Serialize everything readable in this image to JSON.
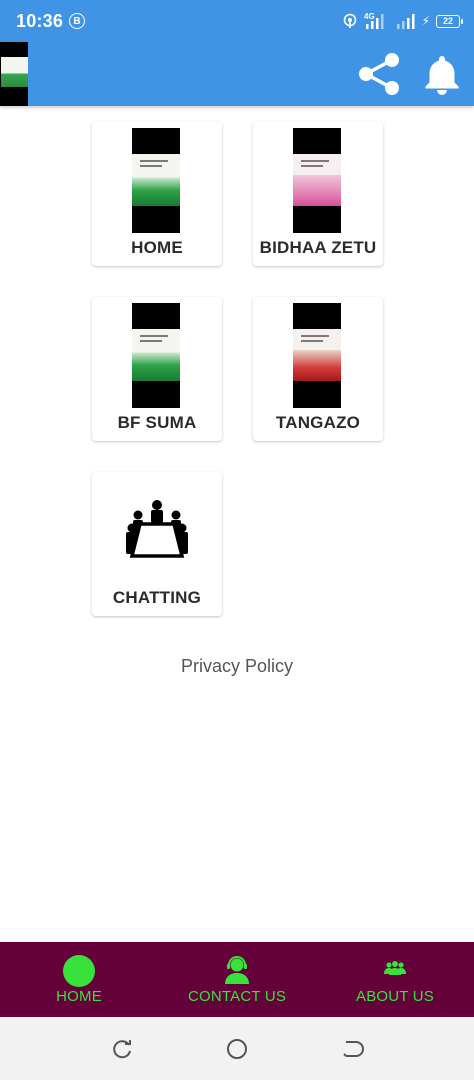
{
  "status_bar": {
    "time": "10:36",
    "b_badge": "B",
    "network": "4G",
    "battery": "22"
  },
  "app_bar": {
    "logo_icon": "app-logo",
    "share_icon": "share-icon",
    "bell_icon": "bell-icon"
  },
  "menu": {
    "items": [
      {
        "label": "HOME",
        "thumb": "green"
      },
      {
        "label": "BIDHAA ZETU",
        "thumb": "pink"
      },
      {
        "label": "BF SUMA",
        "thumb": "green"
      },
      {
        "label": "TANGAZO",
        "thumb": "red"
      },
      {
        "label": "CHATTING",
        "icon": "meeting-table-icon"
      }
    ]
  },
  "privacy_link": "Privacy Policy",
  "bottom_nav": {
    "items": [
      {
        "label": "HOME",
        "icon": "circle-icon"
      },
      {
        "label": "CONTACT US",
        "icon": "support-agent-icon"
      },
      {
        "label": "ABOUT US",
        "icon": "group-icon"
      }
    ],
    "background": "#64003a",
    "accent": "#39e23a"
  },
  "system_nav": {
    "recent_icon": "recent-apps-icon",
    "home_icon": "home-circle-icon",
    "back_icon": "back-icon"
  },
  "colors": {
    "app_bar": "#3f94e6",
    "bottom_nav": "#64003a",
    "nav_accent": "#39e23a"
  }
}
